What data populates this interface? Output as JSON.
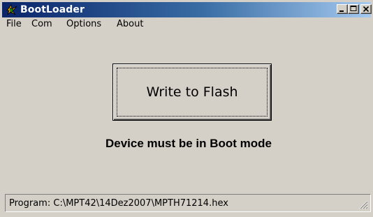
{
  "window": {
    "title": "BootLoader"
  },
  "menu": {
    "items": [
      {
        "label": "File"
      },
      {
        "label": "Com"
      },
      {
        "label": "Options"
      },
      {
        "label": "About"
      }
    ]
  },
  "main": {
    "write_button_label": "Write to Flash",
    "message": "Device must be in Boot mode"
  },
  "statusbar": {
    "text": "Program: C:\\MPT42\\14Dez2007\\MPTH71214.hex"
  },
  "icons": {
    "app": "app-logo-icon",
    "minimize": "minimize-icon",
    "maximize": "maximize-icon",
    "close": "close-icon",
    "grip": "resize-grip-icon"
  },
  "colors": {
    "titlebar_start": "#0a246a",
    "titlebar_end": "#a6caf0",
    "face": "#d4d0c8"
  }
}
